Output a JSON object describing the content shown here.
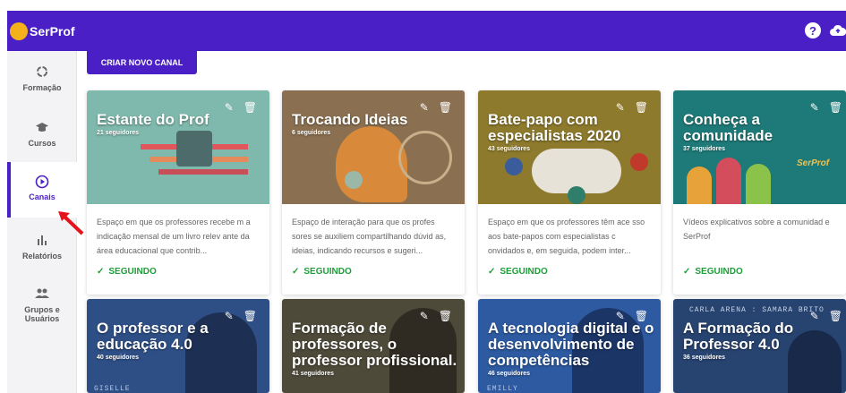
{
  "app": {
    "logo": "SerProf"
  },
  "header": {
    "help_icon": "help-circle-icon",
    "cloud_icon": "cloud-upload-icon"
  },
  "sidebar": {
    "items": [
      {
        "label": "Formação",
        "icon": "loading-circle-icon"
      },
      {
        "label": "Cursos",
        "icon": "graduation-cap-icon"
      },
      {
        "label": "Canais",
        "icon": "play-circle-icon",
        "active": true
      },
      {
        "label": "Relatórios",
        "icon": "bar-chart-icon"
      },
      {
        "label": "Grupos e Usuários",
        "icon": "people-icon"
      }
    ]
  },
  "actions": {
    "new_channel": "CRIAR NOVO CANAL"
  },
  "follow_label": "SEGUINDO",
  "cards": [
    {
      "title": "Estante do Prof",
      "followers": "21 seguidores",
      "desc": "Espaço em que os professores recebe m a indicação mensal de um livro relev ante da área educacional que contrib...",
      "bg": "#7fb8ac"
    },
    {
      "title": "Trocando Ideias",
      "followers": "6 seguidores",
      "desc": "Espaço de interação para que os profes sores se auxiliem compartilhando dúvid as, ideias, indicando recursos e sugeri...",
      "bg": "#8a7050"
    },
    {
      "title": "Bate-papo com especialistas 2020",
      "followers": "43 seguidores",
      "desc": "Espaço em que os professores têm ace sso aos bate-papos com especialistas c onvidados e, em seguida, podem inter...",
      "bg": "#8d7a2c"
    },
    {
      "title": "Conheça a comunidade",
      "followers": "37 seguidores",
      "desc": "Vídeos explicativos sobre a comunidad e SerProf",
      "bg": "#1e7a78"
    },
    {
      "title": "O professor e a educação 4.0",
      "followers": "40 seguidores",
      "bg": "#2e4f86"
    },
    {
      "title": "Formação de professores, o professor profissional.",
      "followers": "41 seguidores",
      "bg": "#4e4a3a"
    },
    {
      "title": "A tecnologia digital e o desenvolvimento de competências",
      "followers": "46 seguidores",
      "bg": "#2d5aa0"
    },
    {
      "title": "A Formação do Professor 4.0",
      "followers": "36 seguidores",
      "bg": "#27436f"
    }
  ],
  "overlays": {
    "giselle": "GISELLE",
    "emilly": "EMILLY",
    "carla": "CARLA ARENA : SAMARA BRITO",
    "serprof_badge": "SerProf"
  }
}
